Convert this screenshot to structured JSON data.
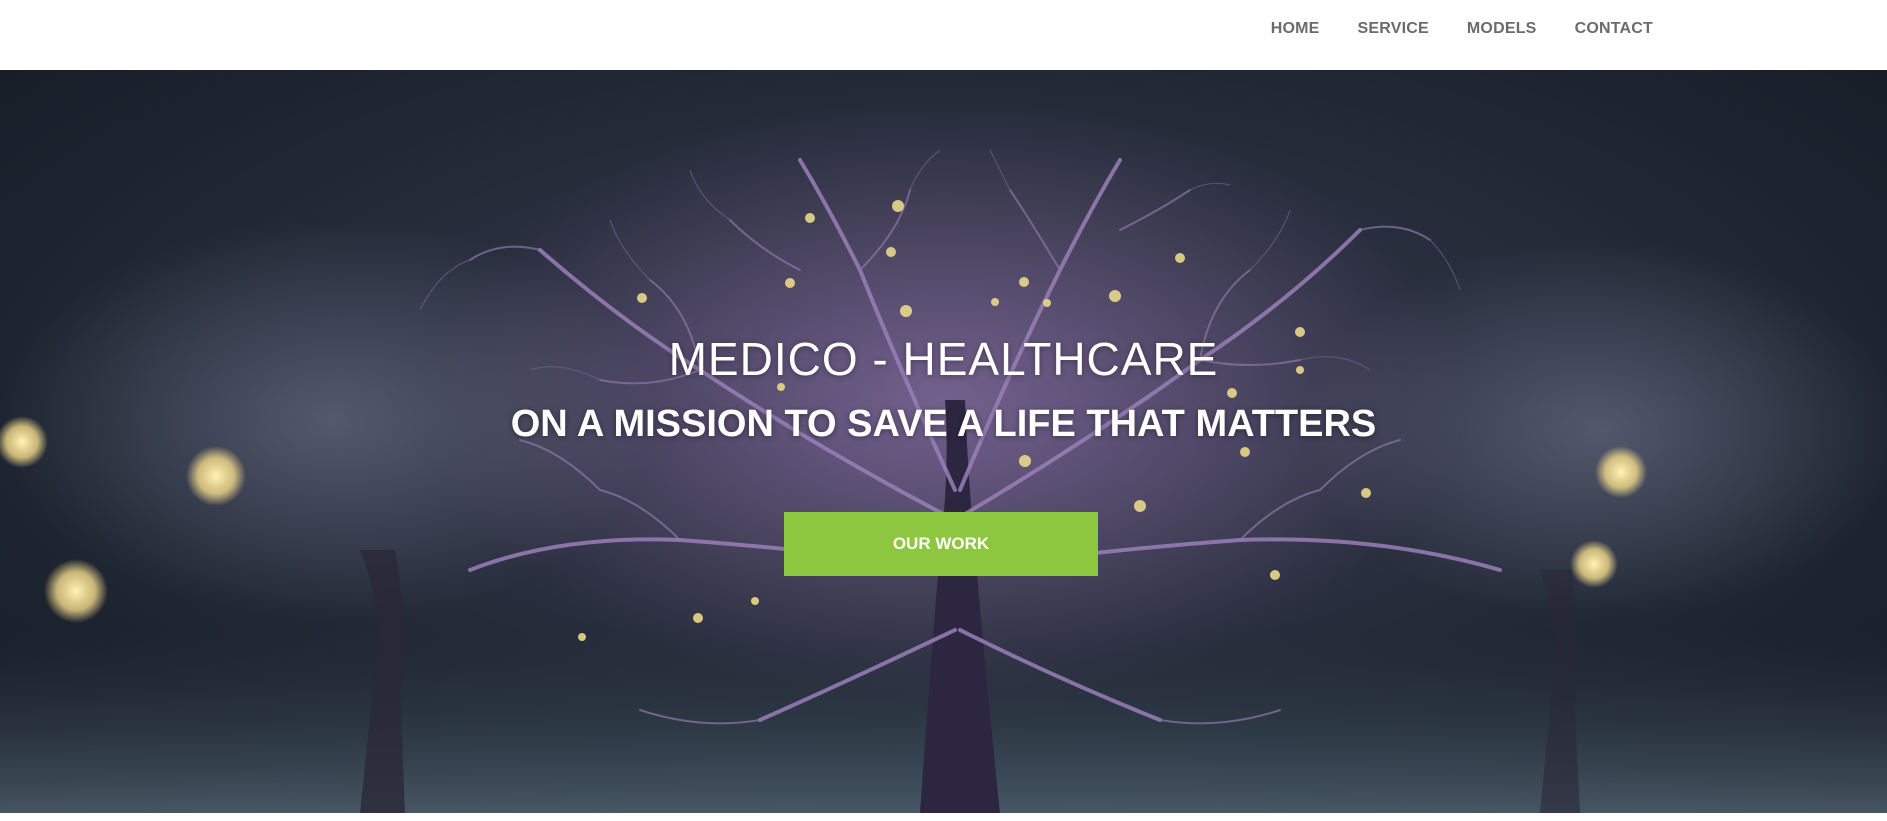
{
  "nav": {
    "items": [
      {
        "label": "HOME"
      },
      {
        "label": "SERVICE"
      },
      {
        "label": "MODELS"
      },
      {
        "label": "CONTACT"
      }
    ]
  },
  "hero": {
    "title": "MEDICO - HEALTHCARE",
    "subtitle": "ON A MISSION TO SAVE A LIFE THAT MATTERS",
    "cta_label": "OUR WORK",
    "background_image": "glowing-neural-tree-image"
  },
  "colors": {
    "accent": "#8dc63f",
    "nav_text": "#6b6b6b",
    "hero_text": "#ffffff"
  }
}
